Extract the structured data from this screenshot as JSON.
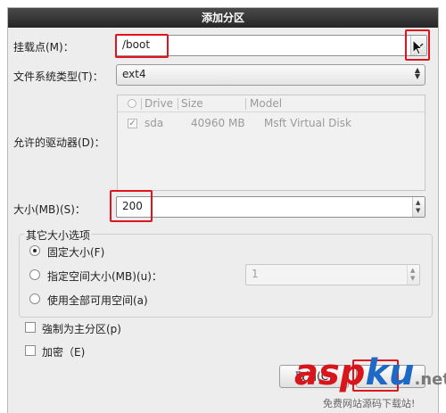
{
  "dialog": {
    "title": "添加分区"
  },
  "mount_point": {
    "label": "挂载点(M)：",
    "value": "/boot"
  },
  "fs_type": {
    "label": "文件系统类型(T)：",
    "value": "ext4"
  },
  "drives": {
    "label": "允许的驱动器(D)：",
    "columns": [
      "Drive",
      "Size",
      "Model"
    ],
    "rows": [
      {
        "checked": true,
        "drive": "sda",
        "size": "40960 MB",
        "model": "Msft Virtual Disk"
      }
    ]
  },
  "size": {
    "label": "大小(MB)(S)：",
    "value": "200"
  },
  "size_options": {
    "title": "其它大小选项",
    "fixed": "固定大小(F)",
    "up_to": "指定空间大小(MB)(u)：",
    "up_to_value": "1",
    "fill": "使用全部可用空间(a)",
    "selected": "fixed"
  },
  "force_primary": {
    "label": "強制为主分区(p)",
    "checked": false
  },
  "encrypt": {
    "label": "加密（E)",
    "checked": false
  },
  "buttons": {
    "cancel": "取消(C)"
  },
  "watermark": {
    "brand_red": "asp",
    "brand_blue": "ku",
    "brand_suffix": ".net",
    "tagline": "免费网站源码下载站!"
  },
  "colors": {
    "highlight": "#e0141a",
    "title_bg": "#2e2e2e",
    "brand_red": "#d9151c",
    "brand_blue": "#1f69c6"
  }
}
